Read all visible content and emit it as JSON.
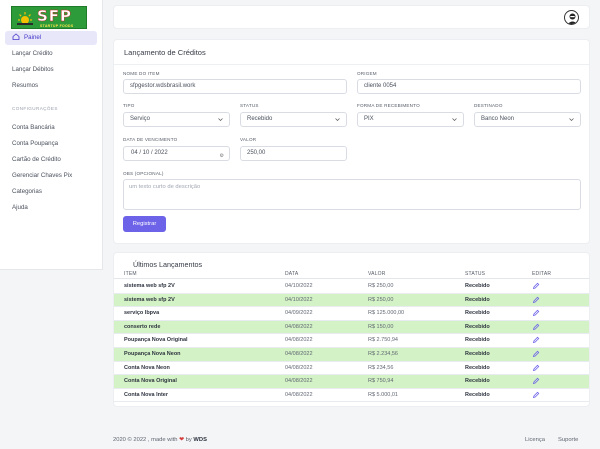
{
  "brand": {
    "logo_text": "SFP",
    "logo_subtext": "STARTUP FOODS"
  },
  "sidebar": {
    "items": [
      {
        "label": "Painel",
        "active": true
      },
      {
        "label": "Lançar Crédito"
      },
      {
        "label": "Lançar Débitos"
      },
      {
        "label": "Resumos"
      }
    ],
    "section_label": "CONFIGURAÇÕES",
    "config_items": [
      {
        "label": "Conta Bancária"
      },
      {
        "label": "Conta Poupança"
      },
      {
        "label": "Cartão de Crédito"
      },
      {
        "label": "Gerenciar Chaves Pix"
      },
      {
        "label": "Categorias"
      },
      {
        "label": "Ajuda"
      }
    ]
  },
  "form": {
    "title": "Lançamento de Créditos",
    "nome_label": "NOME DO ITEM",
    "nome_value": "sfpgestor.wdsbrasil.work",
    "origem_label": "ORIGEM",
    "origem_value": "cliente 0054",
    "tipo_label": "TIPO",
    "tipo_value": "Serviço",
    "status_label": "STATUS",
    "status_value": "Recebido",
    "forma_label": "FORMA DE RECEBIMENTO",
    "forma_value": "PIX",
    "destinado_label": "DESTINADO",
    "destinado_value": "Banco Neon",
    "data_label": "DATA DE VENCIMENTO",
    "data_value": "04 / 10 / 2022",
    "valor_label": "VALOR",
    "valor_value": "250,00",
    "obs_label": "OBS (OPCIONAL)",
    "obs_placeholder": "um texto curto de descrição",
    "submit_label": "Registrar"
  },
  "table": {
    "title": "Últimos Lançamentos",
    "columns": [
      "ITEM",
      "DATA",
      "VALOR",
      "STATUS",
      "EDITAR"
    ],
    "rows": [
      {
        "item": "sistema web sfp 2V",
        "data": "04/10/2022",
        "valor": "R$ 250,00",
        "status": "Recebido",
        "highlight": false
      },
      {
        "item": "sistema web sfp 2V",
        "data": "04/10/2022",
        "valor": "R$ 250,00",
        "status": "Recebido",
        "highlight": true
      },
      {
        "item": "serviço lbpva",
        "data": "04/09/2022",
        "valor": "R$ 125.000,00",
        "status": "Recebido",
        "highlight": false
      },
      {
        "item": "conserto rede",
        "data": "04/08/2022",
        "valor": "R$ 150,00",
        "status": "Recebido",
        "highlight": true
      },
      {
        "item": "Poupança Nova Original",
        "data": "04/08/2022",
        "valor": "R$ 2.750,94",
        "status": "Recebido",
        "highlight": false
      },
      {
        "item": "Poupança Nova Neon",
        "data": "04/08/2022",
        "valor": "R$ 2.234,56",
        "status": "Recebido",
        "highlight": true
      },
      {
        "item": "Conta Nova Neon",
        "data": "04/08/2022",
        "valor": "R$ 234,56",
        "status": "Recebido",
        "highlight": false
      },
      {
        "item": "Conta Nova Original",
        "data": "04/08/2022",
        "valor": "R$ 750,94",
        "status": "Recebido",
        "highlight": true
      },
      {
        "item": "Conta Nova Inter",
        "data": "04/08/2022",
        "valor": "R$ 5.000,01",
        "status": "Recebido",
        "highlight": false
      }
    ]
  },
  "footer": {
    "copyright": "2020 © 2022 , made with",
    "by": "by",
    "author": "WDS",
    "links": [
      "Licença",
      "Suporte"
    ]
  },
  "colors": {
    "accent": "#6d63e8",
    "highlight_row": "#d3f2c5",
    "heart": "#d63a3a"
  }
}
